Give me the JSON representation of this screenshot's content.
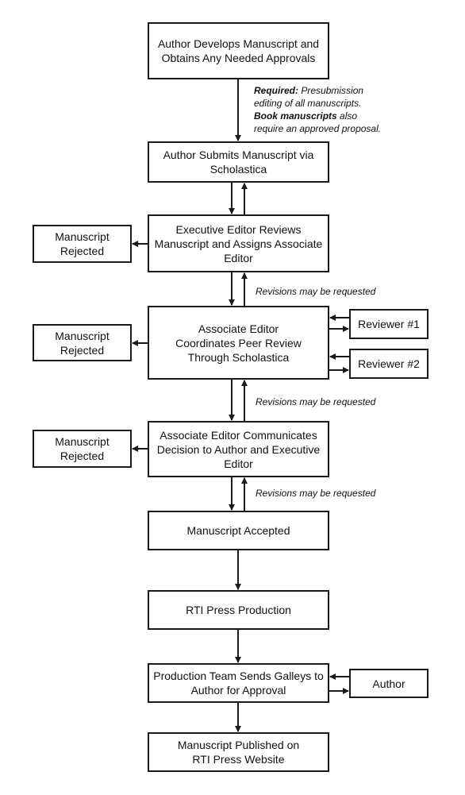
{
  "steps": {
    "develop": "Author Develops Manuscript and Obtains Any Needed Approvals",
    "submit": "Author Submits Manuscript via Scholastica",
    "exec_review": "Executive Editor Reviews Manuscript and Assigns Associate Editor",
    "peer_review": "Associate Editor Coordinates Peer Review Through Scholastica",
    "communicate": "Associate Editor Communicates Decision to Author and Executive Editor",
    "accepted": "Manuscript Accepted",
    "production": "RTI Press Production",
    "galleys": "Production Team Sends Galleys to Author for Approval",
    "published": "Manuscript Published on RTI Press Website"
  },
  "side": {
    "rejected": "Manuscript Rejected",
    "reviewer1": "Reviewer #1",
    "reviewer2": "Reviewer #2",
    "author": "Author"
  },
  "notes": {
    "required_label": "Required:",
    "required_text": " Presubmission",
    "required_line2": "editing of all manuscripts.",
    "book_label": "Book manuscripts",
    "book_text": " also",
    "book_line2": "require an approved proposal.",
    "revisions": "Revisions may be  requested"
  }
}
